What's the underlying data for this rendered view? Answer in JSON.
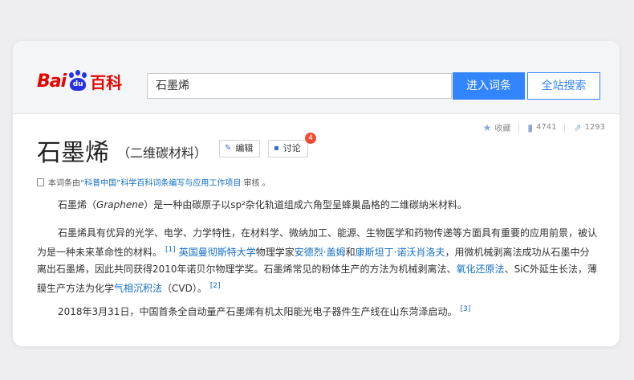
{
  "logo": {
    "part1": "Bai",
    "paw_text": "du",
    "part2": "百科"
  },
  "search": {
    "value": "石墨烯",
    "enter_label": "进入词条",
    "site_search_label": "全站搜索"
  },
  "stats": {
    "collect_label": "收藏",
    "like_count": "4741",
    "share_count": "1293"
  },
  "entry": {
    "title": "石墨烯",
    "subtitle": "（二维碳材料）",
    "edit_label": "编辑",
    "discuss_label": "讨论",
    "discuss_badge": "4"
  },
  "notice": {
    "prefix": "本词条由",
    "link": "“科普中国”科学百科词条编写与应用工作项目",
    "suffix": " 审核 。"
  },
  "para1": {
    "a": "石墨烯（",
    "b": "Graphene",
    "c": "）是一种由碳原子以sp²杂化轨道组成六角型呈蜂巢晶格的二维碳纳米材料。"
  },
  "para2": {
    "a": "石墨烯具有优异的光学、电学、力学特性，在材料学、微纳加工、能源、生物医学和药物传递等方面具有重要的应用前景，被认为是一种未来革命性的材料。",
    "ref1": "[1]",
    "link1": "英国曼彻斯特大学",
    "b": "物理学家",
    "link2": "安德烈·盖姆",
    "c": "和",
    "link3": "康斯坦丁·诺沃肖洛夫",
    "d": "，用微机械剥离法成功从石墨中分离出石墨烯，因此共同获得2010年诺贝尔物理学奖。石墨烯常见的粉体生产的方法为机械剥离法、",
    "link4": "氧化还原法",
    "e": "、SiC外延生长法，薄膜生产方法为化学",
    "link5": "气相沉积法",
    "f": "（CVD）。",
    "ref2": "[2]"
  },
  "para3": {
    "a": "2018年3月31日，中国首条全自动量产石墨烯有机太阳能光电子器件生产线在山东菏泽启动。",
    "ref3": "[3]"
  }
}
